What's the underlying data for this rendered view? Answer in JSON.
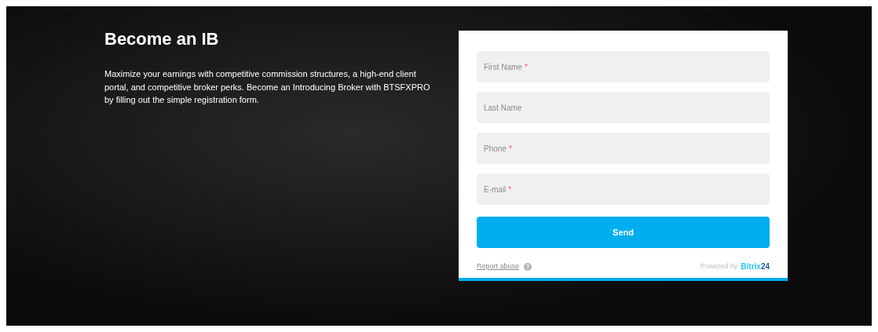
{
  "intro": {
    "title": "Become an IB",
    "text": "Maximize your earnings with competitive commission structures, a high-end client portal, and competitive broker perks. Become an Introducing Broker with BTSFXPRO by filling out the simple registration form."
  },
  "form": {
    "fields": [
      {
        "placeholder": "First Name",
        "required_mark": "*"
      },
      {
        "placeholder": "Last Name"
      },
      {
        "placeholder": "Phone",
        "required_mark": "*"
      },
      {
        "placeholder": "E-mail",
        "required_mark": "*"
      }
    ],
    "submit": "Send",
    "report_link": "Report abuse",
    "powered_by": "Powered by",
    "brand": [
      "Bitrix",
      "24"
    ]
  }
}
